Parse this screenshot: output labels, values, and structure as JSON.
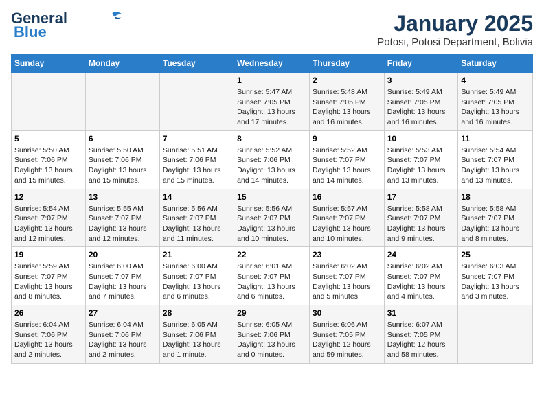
{
  "logo": {
    "text_general": "General",
    "text_blue": "Blue"
  },
  "title": "January 2025",
  "location": "Potosi, Potosi Department, Bolivia",
  "days_of_week": [
    "Sunday",
    "Monday",
    "Tuesday",
    "Wednesday",
    "Thursday",
    "Friday",
    "Saturday"
  ],
  "weeks": [
    [
      {
        "day": "",
        "info": ""
      },
      {
        "day": "",
        "info": ""
      },
      {
        "day": "",
        "info": ""
      },
      {
        "day": "1",
        "info": "Sunrise: 5:47 AM\nSunset: 7:05 PM\nDaylight: 13 hours\nand 17 minutes."
      },
      {
        "day": "2",
        "info": "Sunrise: 5:48 AM\nSunset: 7:05 PM\nDaylight: 13 hours\nand 16 minutes."
      },
      {
        "day": "3",
        "info": "Sunrise: 5:49 AM\nSunset: 7:05 PM\nDaylight: 13 hours\nand 16 minutes."
      },
      {
        "day": "4",
        "info": "Sunrise: 5:49 AM\nSunset: 7:05 PM\nDaylight: 13 hours\nand 16 minutes."
      }
    ],
    [
      {
        "day": "5",
        "info": "Sunrise: 5:50 AM\nSunset: 7:06 PM\nDaylight: 13 hours\nand 15 minutes."
      },
      {
        "day": "6",
        "info": "Sunrise: 5:50 AM\nSunset: 7:06 PM\nDaylight: 13 hours\nand 15 minutes."
      },
      {
        "day": "7",
        "info": "Sunrise: 5:51 AM\nSunset: 7:06 PM\nDaylight: 13 hours\nand 15 minutes."
      },
      {
        "day": "8",
        "info": "Sunrise: 5:52 AM\nSunset: 7:06 PM\nDaylight: 13 hours\nand 14 minutes."
      },
      {
        "day": "9",
        "info": "Sunrise: 5:52 AM\nSunset: 7:07 PM\nDaylight: 13 hours\nand 14 minutes."
      },
      {
        "day": "10",
        "info": "Sunrise: 5:53 AM\nSunset: 7:07 PM\nDaylight: 13 hours\nand 13 minutes."
      },
      {
        "day": "11",
        "info": "Sunrise: 5:54 AM\nSunset: 7:07 PM\nDaylight: 13 hours\nand 13 minutes."
      }
    ],
    [
      {
        "day": "12",
        "info": "Sunrise: 5:54 AM\nSunset: 7:07 PM\nDaylight: 13 hours\nand 12 minutes."
      },
      {
        "day": "13",
        "info": "Sunrise: 5:55 AM\nSunset: 7:07 PM\nDaylight: 13 hours\nand 12 minutes."
      },
      {
        "day": "14",
        "info": "Sunrise: 5:56 AM\nSunset: 7:07 PM\nDaylight: 13 hours\nand 11 minutes."
      },
      {
        "day": "15",
        "info": "Sunrise: 5:56 AM\nSunset: 7:07 PM\nDaylight: 13 hours\nand 10 minutes."
      },
      {
        "day": "16",
        "info": "Sunrise: 5:57 AM\nSunset: 7:07 PM\nDaylight: 13 hours\nand 10 minutes."
      },
      {
        "day": "17",
        "info": "Sunrise: 5:58 AM\nSunset: 7:07 PM\nDaylight: 13 hours\nand 9 minutes."
      },
      {
        "day": "18",
        "info": "Sunrise: 5:58 AM\nSunset: 7:07 PM\nDaylight: 13 hours\nand 8 minutes."
      }
    ],
    [
      {
        "day": "19",
        "info": "Sunrise: 5:59 AM\nSunset: 7:07 PM\nDaylight: 13 hours\nand 8 minutes."
      },
      {
        "day": "20",
        "info": "Sunrise: 6:00 AM\nSunset: 7:07 PM\nDaylight: 13 hours\nand 7 minutes."
      },
      {
        "day": "21",
        "info": "Sunrise: 6:00 AM\nSunset: 7:07 PM\nDaylight: 13 hours\nand 6 minutes."
      },
      {
        "day": "22",
        "info": "Sunrise: 6:01 AM\nSunset: 7:07 PM\nDaylight: 13 hours\nand 6 minutes."
      },
      {
        "day": "23",
        "info": "Sunrise: 6:02 AM\nSunset: 7:07 PM\nDaylight: 13 hours\nand 5 minutes."
      },
      {
        "day": "24",
        "info": "Sunrise: 6:02 AM\nSunset: 7:07 PM\nDaylight: 13 hours\nand 4 minutes."
      },
      {
        "day": "25",
        "info": "Sunrise: 6:03 AM\nSunset: 7:07 PM\nDaylight: 13 hours\nand 3 minutes."
      }
    ],
    [
      {
        "day": "26",
        "info": "Sunrise: 6:04 AM\nSunset: 7:06 PM\nDaylight: 13 hours\nand 2 minutes."
      },
      {
        "day": "27",
        "info": "Sunrise: 6:04 AM\nSunset: 7:06 PM\nDaylight: 13 hours\nand 2 minutes."
      },
      {
        "day": "28",
        "info": "Sunrise: 6:05 AM\nSunset: 7:06 PM\nDaylight: 13 hours\nand 1 minute."
      },
      {
        "day": "29",
        "info": "Sunrise: 6:05 AM\nSunset: 7:06 PM\nDaylight: 13 hours\nand 0 minutes."
      },
      {
        "day": "30",
        "info": "Sunrise: 6:06 AM\nSunset: 7:05 PM\nDaylight: 12 hours\nand 59 minutes."
      },
      {
        "day": "31",
        "info": "Sunrise: 6:07 AM\nSunset: 7:05 PM\nDaylight: 12 hours\nand 58 minutes."
      },
      {
        "day": "",
        "info": ""
      }
    ]
  ]
}
